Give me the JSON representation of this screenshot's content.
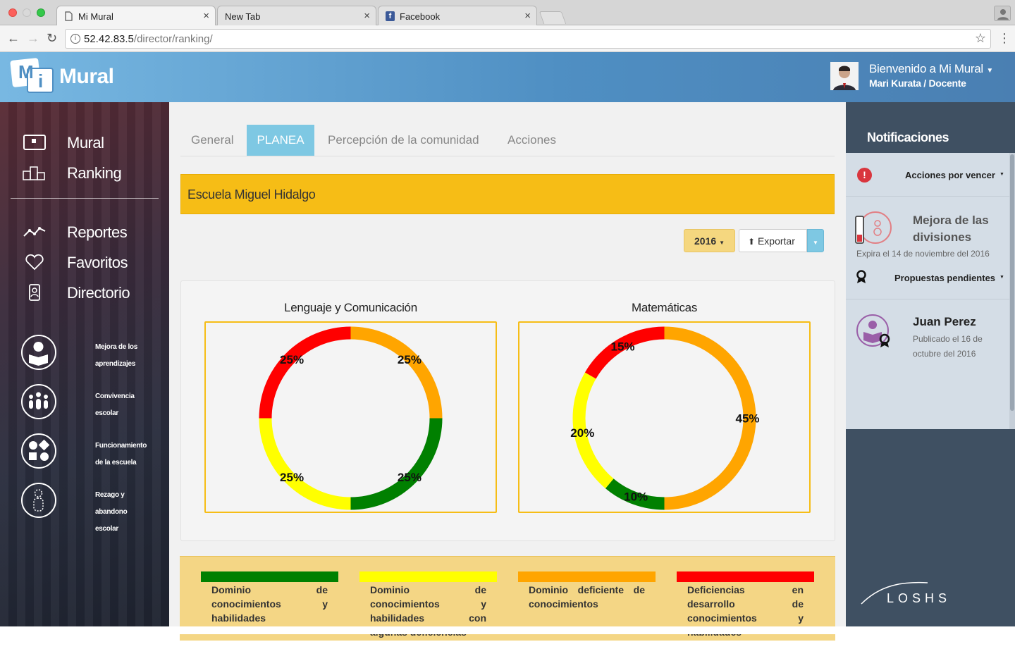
{
  "browser": {
    "tabs": [
      {
        "title": "Mi Mural"
      },
      {
        "title": "New Tab"
      },
      {
        "title": "Facebook"
      }
    ],
    "url_host": "52.42.83.5",
    "url_path": "/director/ranking/"
  },
  "header": {
    "logo_m": "M",
    "logo_i": "i",
    "logo_text": "Mural",
    "welcome": "Bienvenido a Mi Mural",
    "user": "Mari Kurata / Docente"
  },
  "sidebar": {
    "top_items": [
      {
        "label": "Mural",
        "icon": "board-icon"
      },
      {
        "label": "Ranking",
        "icon": "podium-icon"
      }
    ],
    "items": [
      {
        "label": "Reportes",
        "icon": "line-chart-icon"
      },
      {
        "label": "Favoritos",
        "icon": "heart-icon"
      },
      {
        "label": "Directorio",
        "icon": "contact-card-icon"
      }
    ],
    "priorities": [
      {
        "line1": "Mejora de los",
        "line2": "aprendizajes",
        "line3": ""
      },
      {
        "line1": "Convivencia",
        "line2": "escolar",
        "line3": ""
      },
      {
        "line1": "Funcionamiento",
        "line2": "de la escuela",
        "line3": ""
      },
      {
        "line1": "Rezago y",
        "line2": "abandono",
        "line3": "escolar"
      }
    ]
  },
  "tabs": {
    "general": "General",
    "planea": "PLANEA",
    "percepcion": "Percepción de la comunidad",
    "acciones": "Acciones"
  },
  "school": {
    "name": "Escuela Miguel Hidalgo"
  },
  "toolbar": {
    "year": "2016",
    "export": "Exportar"
  },
  "chart_data": [
    {
      "type": "pie",
      "title": "Lenguaje y Comunicación",
      "slices": [
        {
          "label": "Dominio deficiente de conocimientos",
          "value": 25,
          "color": "#ffa500"
        },
        {
          "label": "Dominio de conocimientos y habilidades",
          "value": 25,
          "color": "#008000"
        },
        {
          "label": "Dominio de conocimientos y habilidades con algunas deficiencias",
          "value": 25,
          "color": "#ffff00"
        },
        {
          "label": "Deficiencias en desarrollo de conocimientos y habilidades",
          "value": 25,
          "color": "#ff0000"
        }
      ],
      "data_labels": [
        "25%",
        "25%",
        "25%",
        "25%"
      ]
    },
    {
      "type": "pie",
      "title": "Matemáticas",
      "slices": [
        {
          "label": "Dominio deficiente de conocimientos",
          "value": 45,
          "color": "#ffa500"
        },
        {
          "label": "Dominio de conocimientos y habilidades",
          "value": 10,
          "color": "#008000"
        },
        {
          "label": "Dominio de conocimientos y habilidades con algunas deficiencias",
          "value": 20,
          "color": "#ffff00"
        },
        {
          "label": "Deficiencias en desarrollo de conocimientos y habilidades",
          "value": 15,
          "color": "#ff0000"
        }
      ],
      "data_labels": [
        "45%",
        "10%",
        "20%",
        "15%"
      ]
    }
  ],
  "legend": [
    {
      "color": "#008000",
      "words": [
        "Dominio",
        "de",
        "conocimientos",
        "y",
        "habilidades"
      ]
    },
    {
      "color": "#ffff00",
      "words": [
        "Dominio",
        "de",
        "conocimientos",
        "y",
        "habilidades",
        "con",
        "algunas deficiencias"
      ]
    },
    {
      "color": "#ffa500",
      "words": [
        "Dominio",
        "deficiente",
        "de",
        "conocimientos"
      ]
    },
    {
      "color": "#ff0000",
      "words": [
        "Deficiencias",
        "en",
        "desarrollo",
        "de",
        "conocimientos",
        "y",
        "habilidades"
      ]
    }
  ],
  "notifications": {
    "title": "Notificaciones",
    "acciones_vencer": "Acciones por vencer",
    "card1_title": "Mejora de las divisiones",
    "card1_expiry": "Expira el 14 de noviembre del 2016",
    "propuestas": "Propuestas pendientes",
    "card2_name": "Juan Perez",
    "card2_meta": "Publicado el 16 de octubre del 2016"
  },
  "footer": {
    "brand": "LOSHS"
  }
}
